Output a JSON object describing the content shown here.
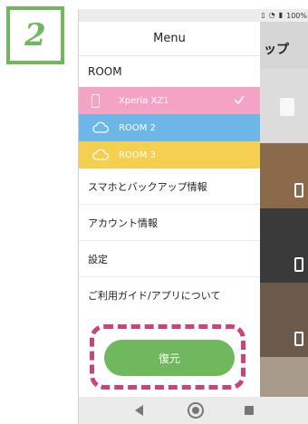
{
  "step": {
    "number": "2"
  },
  "status_bar": {
    "battery": "100%"
  },
  "background_app": {
    "title_fragment": "ップ"
  },
  "drawer": {
    "title": "Menu",
    "section_label": "ROOM",
    "rooms": [
      {
        "label": "Xperia XZ1",
        "icon": "phone-icon",
        "color": "#f4a3c5",
        "selected": true
      },
      {
        "label": "ROOM 2",
        "icon": "cloud-icon",
        "color": "#6cb7e8",
        "selected": false
      },
      {
        "label": "ROOM 3",
        "icon": "cloud-icon",
        "color": "#f5cf4f",
        "selected": false
      }
    ],
    "menu_items": [
      {
        "label": "スマホとバックアップ情報"
      },
      {
        "label": "アカウント情報"
      },
      {
        "label": "設定"
      },
      {
        "label": "ご利用ガイド/アプリについて"
      }
    ],
    "restore_button": "復元"
  },
  "colors": {
    "accent_green": "#6fb85e",
    "highlight_pink": "#c9447a"
  }
}
